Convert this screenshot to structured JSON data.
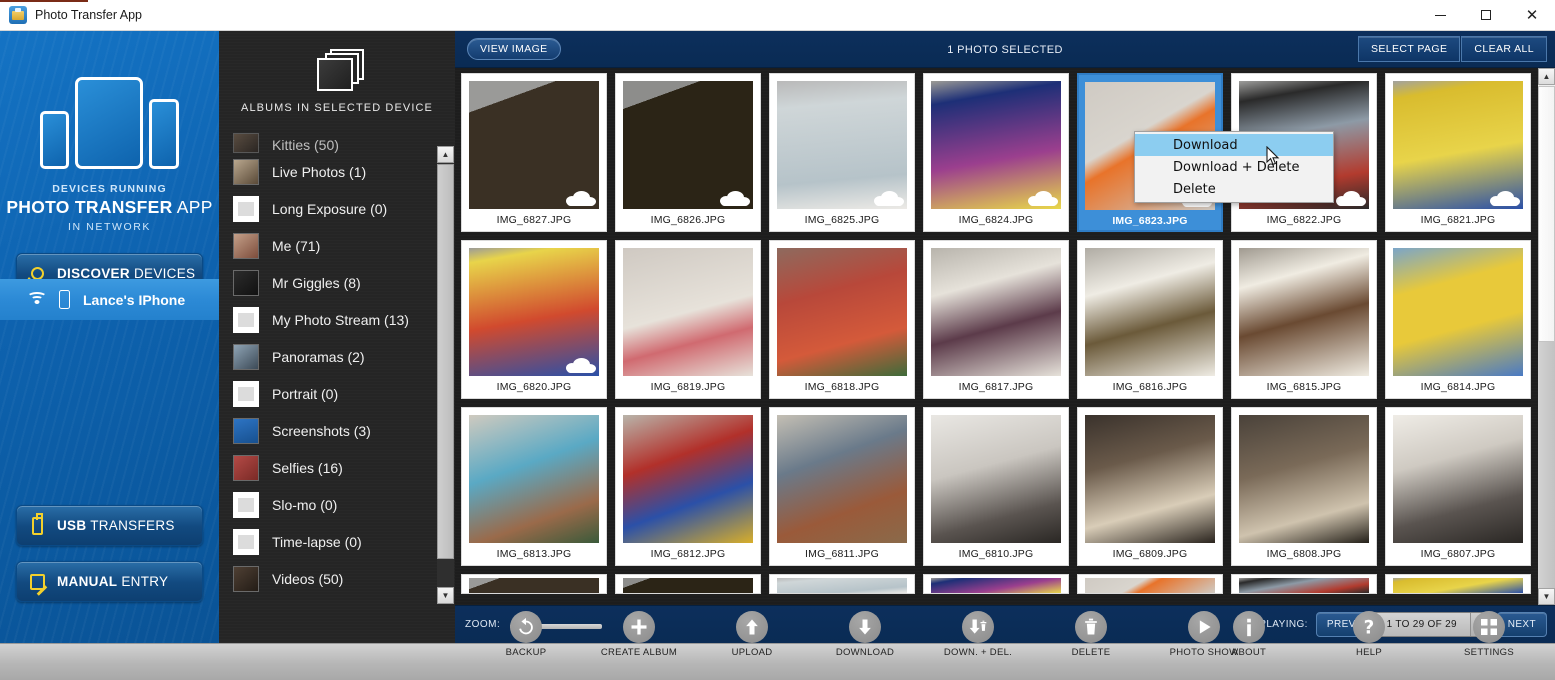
{
  "window": {
    "title": "Photo Transfer App",
    "icon": "app-icon",
    "controls": {
      "minimize": "—",
      "maximize": "□",
      "close": "✕"
    }
  },
  "left_panel": {
    "art_caption_line1": "DEVICES RUNNING",
    "art_caption_line2_bold": "PHOTO TRANSFER",
    "art_caption_line2_rest": " APP",
    "art_caption_line3": "IN NETWORK",
    "discover_button": {
      "bold": "DISCOVER",
      "rest": " DEVICES",
      "icon": "magnifier-icon"
    },
    "device_row": {
      "name": "Lance's IPhone",
      "wifi_icon": "wifi-icon",
      "device_icon": "phone-icon"
    },
    "usb_button": {
      "bold": "USB",
      "rest": " TRANSFERS",
      "icon": "usb-icon"
    },
    "manual_button": {
      "bold": "MANUAL",
      "rest": " ENTRY",
      "icon": "pencil-note-icon"
    }
  },
  "albums_panel": {
    "header": "ALBUMS IN SELECTED DEVICE",
    "header_icon": "album-stack-icon",
    "items": [
      {
        "label": "Kitties (50)",
        "thumb": "photo",
        "partial": true
      },
      {
        "label": "Live Photos (1)",
        "thumb": "photo"
      },
      {
        "label": "Long Exposure (0)",
        "thumb": "placeholder"
      },
      {
        "label": "Me (71)",
        "thumb": "photo"
      },
      {
        "label": "Mr Giggles (8)",
        "thumb": "photo"
      },
      {
        "label": "My Photo Stream (13)",
        "thumb": "stream"
      },
      {
        "label": "Panoramas (2)",
        "thumb": "photo"
      },
      {
        "label": "Portrait (0)",
        "thumb": "placeholder"
      },
      {
        "label": "Screenshots (3)",
        "thumb": "screenshot"
      },
      {
        "label": "Selfies (16)",
        "thumb": "photo"
      },
      {
        "label": "Slo-mo (0)",
        "thumb": "placeholder"
      },
      {
        "label": "Time-lapse (0)",
        "thumb": "placeholder"
      },
      {
        "label": "Videos (50)",
        "thumb": "photo"
      }
    ],
    "scrollbar": {
      "up": "▲",
      "down": "▼"
    }
  },
  "top_toolbar": {
    "view_image_label": "VIEW IMAGE",
    "selection_status": "1 PHOTO SELECTED",
    "select_page_label": "SELECT PAGE",
    "clear_all_label": "CLEAR ALL"
  },
  "photo_grid": {
    "rows": [
      [
        {
          "name": "IMG_6827.JPG",
          "cloud": true,
          "selected": false
        },
        {
          "name": "IMG_6826.JPG",
          "cloud": true,
          "selected": false
        },
        {
          "name": "IMG_6825.JPG",
          "cloud": true,
          "selected": false
        },
        {
          "name": "IMG_6824.JPG",
          "cloud": true,
          "selected": false
        },
        {
          "name": "IMG_6823.JPG",
          "cloud": true,
          "selected": true
        },
        {
          "name": "IMG_6822.JPG",
          "cloud": true,
          "selected": false
        },
        {
          "name": "IMG_6821.JPG",
          "cloud": true,
          "selected": false
        }
      ],
      [
        {
          "name": "IMG_6820.JPG",
          "cloud": true,
          "selected": false
        },
        {
          "name": "IMG_6819.JPG",
          "cloud": false,
          "selected": false
        },
        {
          "name": "IMG_6818.JPG",
          "cloud": false,
          "selected": false
        },
        {
          "name": "IMG_6817.JPG",
          "cloud": false,
          "selected": false
        },
        {
          "name": "IMG_6816.JPG",
          "cloud": false,
          "selected": false
        },
        {
          "name": "IMG_6815.JPG",
          "cloud": false,
          "selected": false
        },
        {
          "name": "IMG_6814.JPG",
          "cloud": false,
          "selected": false
        }
      ],
      [
        {
          "name": "IMG_6813.JPG",
          "cloud": false,
          "selected": false
        },
        {
          "name": "IMG_6812.JPG",
          "cloud": false,
          "selected": false
        },
        {
          "name": "IMG_6811.JPG",
          "cloud": false,
          "selected": false
        },
        {
          "name": "IMG_6810.JPG",
          "cloud": false,
          "selected": false
        },
        {
          "name": "IMG_6809.JPG",
          "cloud": false,
          "selected": false
        },
        {
          "name": "IMG_6808.JPG",
          "cloud": false,
          "selected": false
        },
        {
          "name": "IMG_6807.JPG",
          "cloud": false,
          "selected": false
        }
      ]
    ],
    "scrollbar": {
      "up": "▲",
      "down": "▼"
    }
  },
  "context_menu": {
    "items": [
      {
        "label": "Download",
        "highlighted": true
      },
      {
        "label": "Download + Delete",
        "highlighted": false
      },
      {
        "label": "Delete",
        "highlighted": false
      }
    ]
  },
  "bottom_bar": {
    "zoom_label": "ZOOM:",
    "zoom_value_pct": 10,
    "displaying_label": "DISPLAYING:",
    "prev_label": "PREV",
    "range_value": "1 TO 29 OF 29",
    "next_label": "NEXT",
    "dropdown_icon": "▼"
  },
  "toolbar": {
    "left_tools": [
      {
        "label": "BACKUP",
        "icon": "restore-icon"
      },
      {
        "label": "CREATE ALBUM",
        "icon": "plus-icon"
      },
      {
        "label": "UPLOAD",
        "icon": "arrow-up-icon"
      },
      {
        "label": "DOWNLOAD",
        "icon": "arrow-down-icon"
      },
      {
        "label": "DOWN. + DEL.",
        "icon": "arrow-down-trash-icon"
      },
      {
        "label": "DELETE",
        "icon": "trash-icon"
      },
      {
        "label": "PHOTO SHOW",
        "icon": "play-icon"
      }
    ],
    "right_tools": [
      {
        "label": "ABOUT",
        "icon": "info-icon"
      },
      {
        "label": "HELP",
        "icon": "question-icon"
      },
      {
        "label": "SETTINGS",
        "icon": "grid-dots-icon"
      }
    ]
  },
  "colors": {
    "brand_blue": "#0e63b0",
    "selection_blue": "#3d8fd8",
    "toolbar_navy": "#0c2f5c",
    "panel_dark": "#252525",
    "accent_yellow": "#f2d02c",
    "ctx_highlight": "#8ccdf0"
  }
}
